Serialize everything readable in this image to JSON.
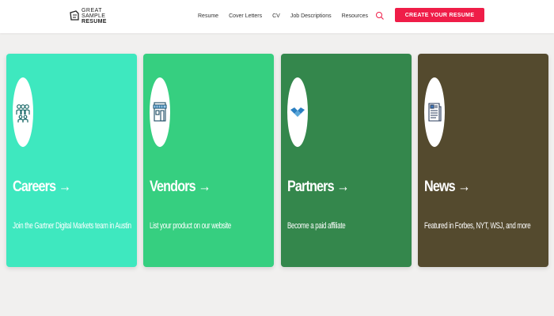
{
  "header": {
    "logo": {
      "line1": "GREAT",
      "line2a": "SAMPLE",
      "line2b": "RESUME"
    },
    "nav": [
      "Resume",
      "Cover Letters",
      "CV",
      "Job Descriptions",
      "Resources"
    ],
    "cta_label": "CREATE YOUR RESUME",
    "accent_color": "#ef1d48"
  },
  "cards": [
    {
      "title": "Careers →",
      "desc": "Join the Gartner Digital Markets team in Austin",
      "icon": "people-icon",
      "color": "#3ee8bf"
    },
    {
      "title": "Vendors →",
      "desc": "List your product on our website",
      "icon": "storefront-icon",
      "color": "#36cf80"
    },
    {
      "title": "Partners →",
      "desc": "Become a paid affiliate",
      "icon": "handshake-icon",
      "color": "#34874c"
    },
    {
      "title": "News →",
      "desc": "Featured in Forbes, NYT, WSJ, and more",
      "icon": "newspaper-icon",
      "color": "#544a2e"
    }
  ]
}
